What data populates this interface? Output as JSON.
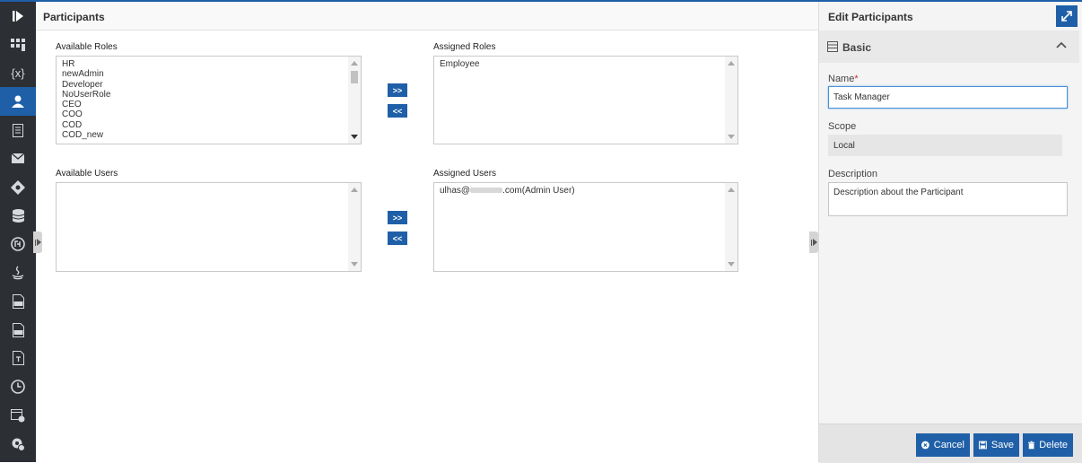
{
  "main": {
    "title": "Participants",
    "available_roles": {
      "label": "Available Roles",
      "items": [
        "HR",
        "newAdmin",
        "Developer",
        "NoUserRole",
        "CEO",
        "COO",
        "COD",
        "COD_new"
      ]
    },
    "assigned_roles": {
      "label": "Assigned Roles",
      "items": [
        "Employee"
      ]
    },
    "available_users": {
      "label": "Available Users",
      "items": []
    },
    "assigned_users": {
      "label": "Assigned Users",
      "item_prefix": "ulhas@",
      "item_suffix": ".com(Admin User)"
    },
    "move_right_label": ">>",
    "move_left_label": "<<"
  },
  "panel": {
    "title": "Edit Participants",
    "section_title": "Basic",
    "name_label": "Name",
    "name_required_mark": "*",
    "name_value": "Task Manager",
    "scope_label": "Scope",
    "scope_value": "Local",
    "description_label": "Description",
    "description_value": "Description about the Participant",
    "cancel_label": "Cancel",
    "save_label": "Save",
    "delete_label": "Delete"
  },
  "rail": {
    "items": [
      "play-icon",
      "dashboard-icon",
      "variable-icon",
      "participant-icon",
      "document-icon",
      "mail-icon",
      "gateway-icon",
      "database-icon",
      "api-icon",
      "java-icon",
      "ts-file-icon",
      "css-file-icon",
      "template-icon",
      "clock-icon",
      "form-settings-icon",
      "settings-icon"
    ],
    "variable_glyph": "{x}",
    "active_index": 3
  },
  "colors": {
    "accent": "#1f5fa8",
    "rail": "#2c2f33",
    "panel": "#f4f4f4"
  }
}
